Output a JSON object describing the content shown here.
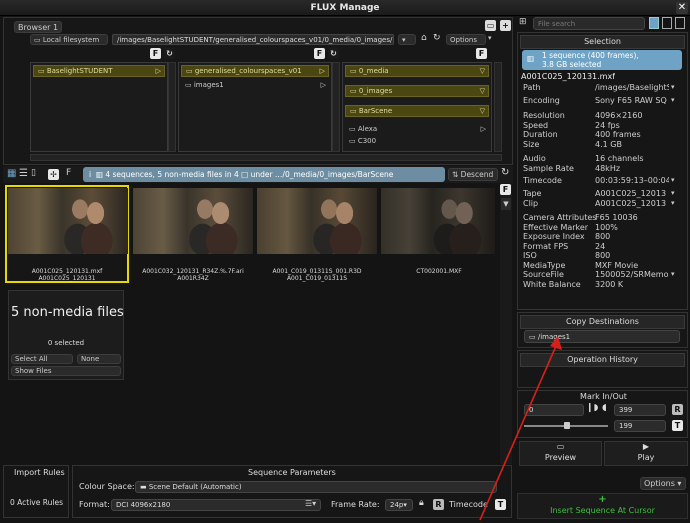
{
  "window": {
    "title": "FLUX Manage",
    "close": "✕"
  },
  "browser": {
    "tab_label": "Browser 1",
    "filesystem_label": "Local filesystem",
    "path": "/images/BaselightSTUDENT/generalised_colourspaces_v01/0_media/0_images/",
    "options_label": "Options",
    "columns": [
      {
        "folders": [
          "BaselightSTUDENT"
        ],
        "items": []
      },
      {
        "folders": [
          "generalised_colourspaces_v01"
        ],
        "items": [
          "images1"
        ]
      },
      {
        "folders": [
          "0_media",
          "0_images",
          "BarScene"
        ],
        "items": [
          "Alexa",
          "C300"
        ]
      }
    ]
  },
  "status": {
    "summary": "4 sequences, 5 non-media files in 4 □ under …/0_media/0_images/BarScene",
    "sort_label": "Descend"
  },
  "thumbnails": [
    {
      "name": "A001C025_120131.mxf",
      "sub": "A001C025_120131"
    },
    {
      "name": "A001C032_120131_R34Z.%.7F.ari",
      "sub": "A001R34Z"
    },
    {
      "name": "A001_C019_01311S_001.R3D",
      "sub": "A001_C019_01311S"
    },
    {
      "name": "CT002001.MXF",
      "sub": ""
    }
  ],
  "nonmedia": {
    "title": "5 non-media files",
    "selected": "0 selected",
    "select_all": "Select All",
    "none": "None",
    "show_files": "Show Files"
  },
  "search": {
    "placeholder": "File search"
  },
  "selection": {
    "header": "Selection",
    "summary_line1": "1 sequence (400 frames),",
    "summary_line2": "3.8 GB selected",
    "filename": "A001C025_120131.mxf",
    "properties": [
      {
        "label": "Path",
        "value": "/images/BaselightS"
      },
      {
        "label": "Encoding",
        "value": "Sony F65 RAW SQ"
      },
      {
        "label": "Resolution",
        "value": "4096×2160"
      },
      {
        "label": "Speed",
        "value": "24 fps"
      },
      {
        "label": "Duration",
        "value": "400 frames"
      },
      {
        "label": "Size",
        "value": "4.1 GB"
      },
      {
        "label": "Audio",
        "value": "16 channels"
      },
      {
        "label": "Sample Rate",
        "value": "48kHz"
      },
      {
        "label": "Timecode",
        "value": "00:03:59:13–00:04"
      },
      {
        "label": "Tape",
        "value": "A001C025_12013"
      },
      {
        "label": "Clip",
        "value": "A001C025_12013"
      },
      {
        "label": "Camera Attributes",
        "value": "F65  10036"
      },
      {
        "label": "Effective Marker",
        "value": "100%"
      },
      {
        "label": "Exposure Index",
        "value": "800"
      },
      {
        "label": "Format FPS",
        "value": "24"
      },
      {
        "label": "ISO",
        "value": "800"
      },
      {
        "label": "MediaType",
        "value": "MXF Movie"
      },
      {
        "label": "SourceFile",
        "value": "1500052/SRMemo"
      },
      {
        "label": "White Balance",
        "value": "3200 K"
      }
    ]
  },
  "copy_destinations": {
    "header": "Copy Destinations",
    "path": "/images1"
  },
  "operation_history": {
    "header": "Operation History"
  },
  "mark": {
    "header": "Mark In/Out",
    "in_value": "0",
    "out_top": "399",
    "out_bottom": "199"
  },
  "playback": {
    "preview": "Preview",
    "play": "Play"
  },
  "options_label": "Options",
  "insert_label": "Insert Sequence At Cursor",
  "import_rules": {
    "header": "Import Rules",
    "count": "0 Active Rules"
  },
  "sequence_params": {
    "header": "Sequence Parameters",
    "colour_space_label": "Colour Space:",
    "colour_space_value": "Scene Default (Automatic)",
    "format_label": "Format:",
    "format_value": "DCI 4096x2180",
    "frame_rate_label": "Frame Rate:",
    "frame_rate_value": "24p",
    "timecode_label": "Timecode"
  },
  "colors": {
    "accent": "#6fa3c6",
    "highlight_yellow": "#e8d800",
    "insert_green": "#3cc03c",
    "arrow_red": "#d8201a"
  }
}
